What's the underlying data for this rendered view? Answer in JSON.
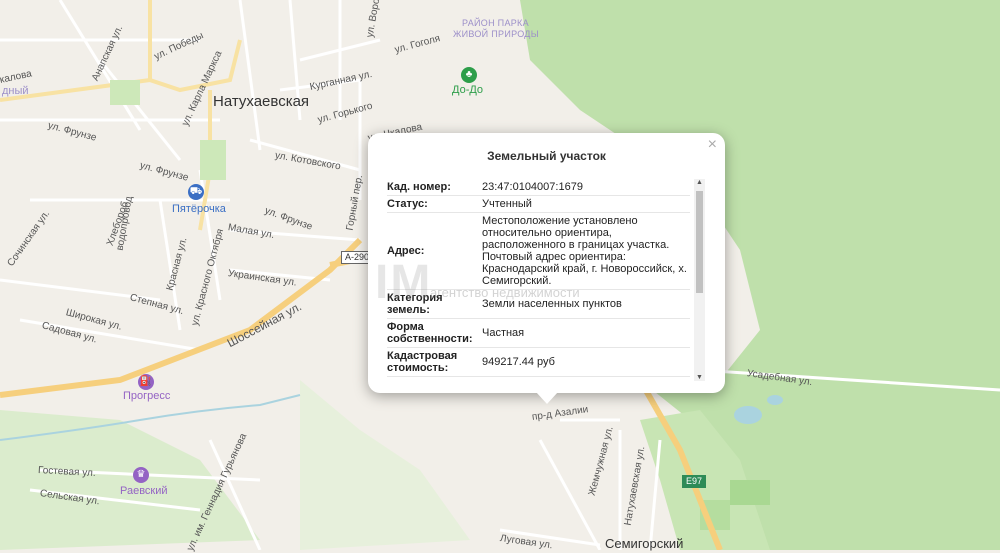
{
  "map": {
    "town": "Натухаевская",
    "park": [
      "РАЙОН ПАРКА",
      "ЖИВОЙ ПРИРОДЫ"
    ],
    "poi_dodo": "До-До",
    "poi_pyaterochka": "Пятёрочка",
    "poi_progress": "Прогресс",
    "poi_raevsky": "Раевский",
    "village": "Семигорский",
    "road_a290": "А-290",
    "road_e97": "E97",
    "partial_label": "дный",
    "streets": {
      "pobedy": "ул. Победы",
      "anapskaya": "Анапская ул.",
      "karla_marksa": "ул. Карла Маркса",
      "gogolya": "ул. Гоголя",
      "vorovskogo": "ул. Воровс",
      "kurgannaya": "Курганная ул.",
      "gorkogo": "ул. Горького",
      "chkalova_top": "ул. Чкалова",
      "kalova": "калова",
      "frunze1": "ул. Фрунзе",
      "frunze2": "ул. Фрунзе",
      "frunze3": "ул. Фрунзе",
      "kotovskogo": "ул. Котовского",
      "gorny": "Горный пер.",
      "sochinskaya": "Сочинская ул.",
      "khlebo": "Хлебороб",
      "vodoprovod": "водопровод",
      "krasnaya": "Красная ул.",
      "oktyabrya": "ул. Красного Октября",
      "malaya": "Малая ул.",
      "ukrainskaya": "Украинская ул.",
      "shosseynaya": "Шоссейная ул.",
      "stepnaya": "Степная ул.",
      "shirokaya": "Широкая ул.",
      "sadovaya": "Садовая ул.",
      "gostevaya": "Гостевая ул.",
      "selskaya": "Сельская ул.",
      "guryanova": "ул. им. Геннадия Гурьянова",
      "azalii": "пр-д Азалии",
      "zhemchuzhnaya": "Жемчужная ул.",
      "natukhaevskaya_st": "Натухаевская ул.",
      "lugovaya": "Луговая ул.",
      "usadebnaya": "Усадебная ул."
    }
  },
  "popup": {
    "title": "Земельный участок",
    "close": "×",
    "rows": [
      {
        "key": "Кад. номер:",
        "value": [
          "23:47:0104007:1679"
        ]
      },
      {
        "key": "Статус:",
        "value": [
          "Учтенный"
        ]
      },
      {
        "key": "Адрес:",
        "value": [
          "Местоположение установлено",
          "относительно ориентира,",
          "расположенного в границах участка.",
          "Почтовый адрес ориентира:",
          "Краснодарский край, г. Новороссийск, х.",
          "Семигорский."
        ]
      },
      {
        "key": [
          "Категория",
          "земель:"
        ],
        "value": [
          "Земли населенных пунктов"
        ]
      },
      {
        "key": [
          "Форма",
          "собственности:"
        ],
        "value": [
          "Частная"
        ]
      },
      {
        "key": [
          "Кадастровая",
          "стоимость:"
        ],
        "value": [
          "949217.44 руб"
        ]
      }
    ]
  },
  "watermark": {
    "big": "IM",
    "small": "агентство недвижимости"
  },
  "colors": {
    "forest": "#b9dfa6",
    "road_major": "#f6cf7d",
    "water": "#aad3df",
    "poi_blue": "#3b6fc4",
    "poi_purple": "#9463c4"
  }
}
